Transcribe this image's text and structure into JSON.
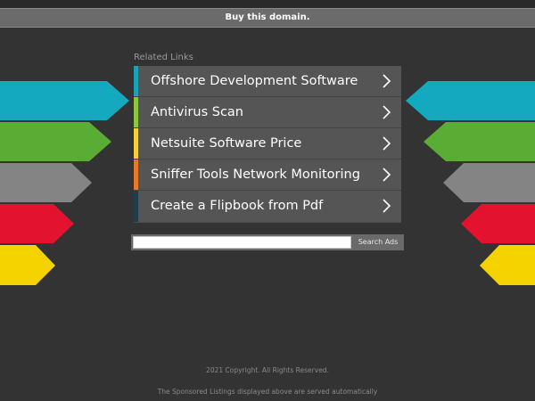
{
  "header": {
    "buy_domain_label": "Buy this domain."
  },
  "related": {
    "label": "Related Links",
    "items": [
      {
        "label": "Offshore Development Software",
        "accent": "#1aa3b5"
      },
      {
        "label": "Antivirus Scan",
        "accent": "#8dc63f"
      },
      {
        "label": "Netsuite Software Price",
        "accent": "#f4d03f"
      },
      {
        "label": "Sniffer Tools Network Monitoring",
        "accent": "#e8782a"
      },
      {
        "label": "Create a Flipbook from Pdf",
        "accent": "#1f3c4a"
      }
    ]
  },
  "search": {
    "input_value": "",
    "button_label": "Search Ads"
  },
  "footer": {
    "copyright": "2021 Copyright. All Rights Reserved.",
    "disclaimer": "The Sponsored Listings displayed above are served automatically"
  },
  "decor": {
    "colors": [
      "#13aabf",
      "#5aad34",
      "#848484",
      "#e3132f",
      "#f5d300"
    ]
  }
}
